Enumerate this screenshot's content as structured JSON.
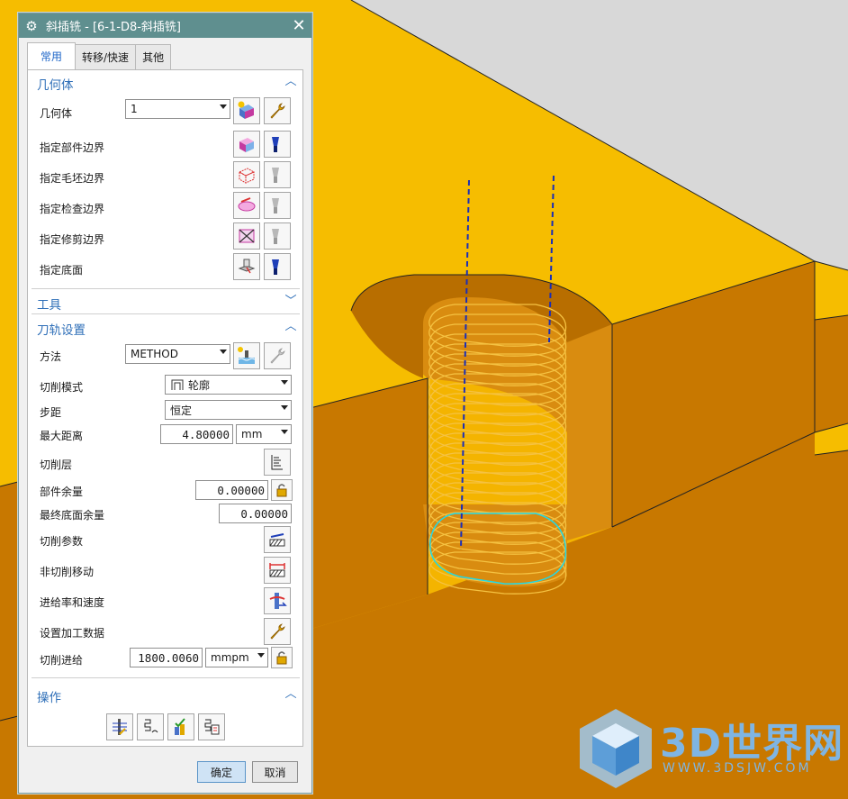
{
  "dialog": {
    "title": "斜插铣 - [6-1-D8-斜插铣]",
    "tabs": [
      {
        "label": "常用",
        "active": true
      },
      {
        "label": "转移/快速",
        "active": false
      },
      {
        "label": "其他",
        "active": false
      }
    ]
  },
  "geometry": {
    "header": "几何体",
    "geometry_label": "几何体",
    "geometry_value": "1",
    "rows": [
      {
        "label": "指定部件边界"
      },
      {
        "label": "指定毛坯边界"
      },
      {
        "label": "指定检查边界"
      },
      {
        "label": "指定修剪边界"
      },
      {
        "label": "指定底面"
      }
    ]
  },
  "tools": {
    "header": "工具"
  },
  "path": {
    "header": "刀轨设置",
    "method_label": "方法",
    "method_value": "METHOD",
    "cut_mode_label": "切削模式",
    "cut_mode_value": "轮廓",
    "stepover_label": "步距",
    "stepover_value": "恒定",
    "max_dist_label": "最大距离",
    "max_dist_value": "4.80000",
    "max_dist_unit": "mm",
    "cut_levels_label": "切削层",
    "part_stock_label": "部件余量",
    "part_stock_value": "0.00000",
    "floor_stock_label": "最终底面余量",
    "floor_stock_value": "0.00000",
    "cut_params_label": "切削参数",
    "noncut_label": "非切削移动",
    "feeds_label": "进给率和速度",
    "machining_data_label": "设置加工数据",
    "cut_feed_label": "切削进给",
    "cut_feed_value": "1800.0060",
    "cut_feed_unit": "mmpm"
  },
  "actions": {
    "header": "操作"
  },
  "buttons": {
    "ok": "确定",
    "cancel": "取消"
  },
  "watermark": {
    "text": "3D世界网",
    "url": "WWW.3DSJW.COM"
  },
  "colors": {
    "model": "#f4b400",
    "model_side": "#c87800",
    "background": "#d9d9d9",
    "toolpath": "#f5c242",
    "tool_axis": "#1a2eb8",
    "titlebar": "#5f8f8f",
    "accent": "#2f6fb8"
  }
}
